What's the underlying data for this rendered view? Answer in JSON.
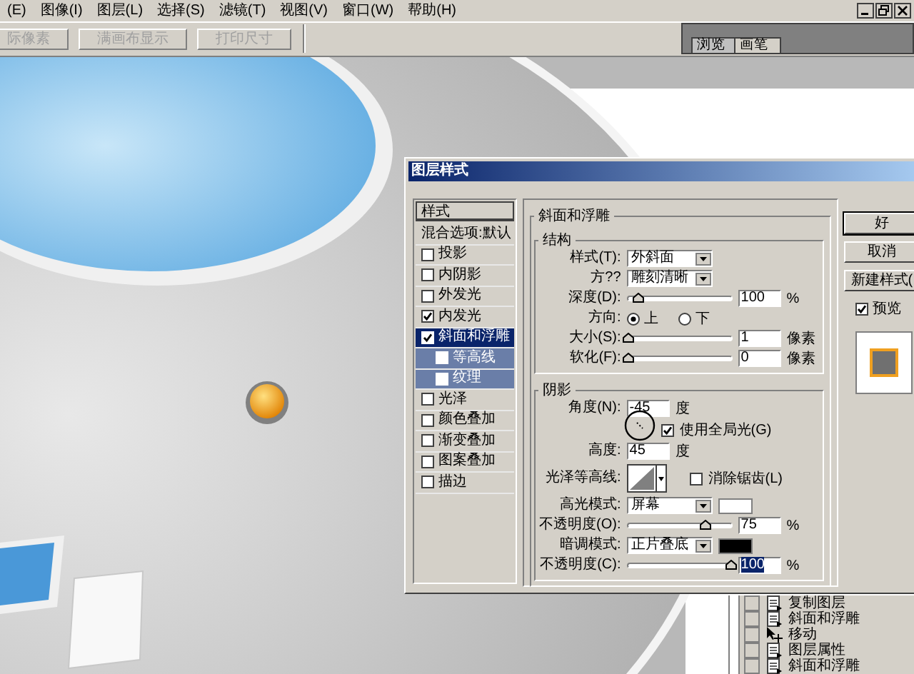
{
  "menu": [
    {
      "label": "(E)"
    },
    {
      "label": "图像(I)"
    },
    {
      "label": "图层(L)"
    },
    {
      "label": "选择(S)"
    },
    {
      "label": "滤镜(T)"
    },
    {
      "label": "视图(V)"
    },
    {
      "label": "窗口(W)"
    },
    {
      "label": "帮助(H)"
    }
  ],
  "toolbar": {
    "buttons": [
      {
        "label": "际像素",
        "disabled": true
      },
      {
        "label": "满画布显示",
        "disabled": true
      },
      {
        "label": "打印尺寸",
        "disabled": true
      }
    ],
    "palette_tabs": [
      {
        "label": "浏览",
        "selected": false
      },
      {
        "label": "画笔",
        "selected": true
      }
    ]
  },
  "dialog": {
    "title": "图层样式",
    "styles": {
      "header": "样式",
      "blend_options": "混合选项:默认",
      "items": [
        {
          "label": "投影",
          "checked": false,
          "selected": false
        },
        {
          "label": "内阴影",
          "checked": false,
          "selected": false
        },
        {
          "label": "外发光",
          "checked": false,
          "selected": false
        },
        {
          "label": "内发光",
          "checked": true,
          "selected": false
        },
        {
          "label": "斜面和浮雕",
          "checked": true,
          "selected": true,
          "children": [
            {
              "label": "等高线",
              "checked": false,
              "selected": false
            },
            {
              "label": "纹理",
              "checked": false,
              "selected": false
            }
          ]
        },
        {
          "label": "光泽",
          "checked": false,
          "selected": false
        },
        {
          "label": "颜色叠加",
          "checked": false,
          "selected": false
        },
        {
          "label": "渐变叠加",
          "checked": false,
          "selected": false
        },
        {
          "label": "图案叠加",
          "checked": false,
          "selected": false
        },
        {
          "label": "描边",
          "checked": false,
          "selected": false
        }
      ]
    },
    "bevel": {
      "title": "斜面和浮雕",
      "structure": {
        "title": "结构",
        "rows": [
          {
            "kind": "select",
            "label": "样式(T):",
            "value": "外斜面"
          },
          {
            "kind": "select",
            "label": "方??",
            "value": "雕刻清晰"
          },
          {
            "kind": "slider",
            "label": "深度(D):",
            "level": 0.1,
            "value": "100",
            "unit": "%",
            "value_selected": false
          },
          {
            "kind": "radio",
            "label": "方向:",
            "options": [
              {
                "label": "上",
                "selected": true
              },
              {
                "label": "下",
                "selected": false
              }
            ]
          },
          {
            "kind": "slider",
            "label": "大小(S):",
            "level": 0,
            "value": "1",
            "unit": "像素",
            "value_selected": false
          },
          {
            "kind": "slider",
            "label": "软化(F):",
            "level": 0,
            "value": "0",
            "unit": "像素",
            "value_selected": false
          }
        ]
      },
      "shading": {
        "title": "阴影",
        "angle": {
          "label": "角度(N):",
          "value": "-45",
          "unit": "度"
        },
        "global_light": {
          "label": "使用全局光(G)",
          "checked": true
        },
        "altitude": {
          "label": "高度:",
          "value": "45",
          "unit": "度"
        },
        "gloss_contour": {
          "label": "光泽等高线:"
        },
        "anti_alias": {
          "label": "消除锯齿(L)",
          "checked": false
        },
        "rows": [
          {
            "kind": "mode",
            "label": "高光模式:",
            "value": "屏幕",
            "color": "#ffffff"
          },
          {
            "kind": "slider",
            "label": "不透明度(O):",
            "level": 0.75,
            "value": "75",
            "unit": "%",
            "value_selected": false
          },
          {
            "kind": "mode",
            "label": "暗调模式:",
            "value": "正片叠底",
            "color": "#000000"
          },
          {
            "kind": "slider",
            "label": "不透明度(C):",
            "level": 1,
            "value": "100",
            "unit": "%",
            "value_selected": true
          }
        ]
      }
    },
    "buttons": [
      {
        "label": "好"
      },
      {
        "label": "取消"
      },
      {
        "label": "新建样式("
      }
    ],
    "preview": {
      "label": "预览",
      "checked": true
    }
  },
  "history": {
    "items": [
      {
        "kind": "document",
        "label": "复制图层",
        "checked": false
      },
      {
        "kind": "document",
        "label": "斜面和浮雕",
        "checked": false
      },
      {
        "kind": "move",
        "label": "移动",
        "checked": false
      },
      {
        "kind": "document",
        "label": "图层属性",
        "checked": false
      },
      {
        "kind": "document",
        "label": "斜面和浮雕",
        "checked": false
      }
    ]
  }
}
